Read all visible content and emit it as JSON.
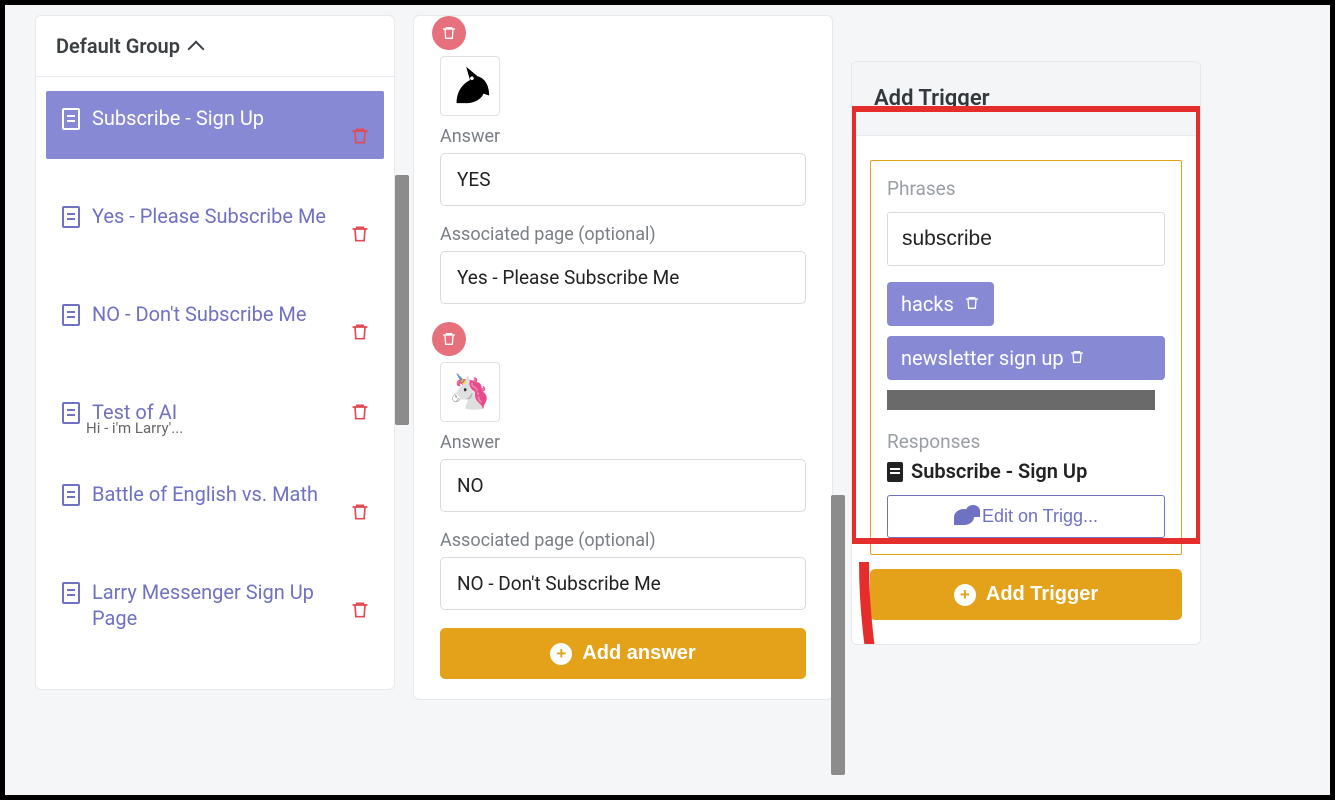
{
  "sidebar": {
    "title": "Default Group",
    "items": [
      {
        "label": "Subscribe - Sign Up",
        "active": true
      },
      {
        "label": "Yes - Please Subscribe Me"
      },
      {
        "label": "NO - Don't Subscribe Me"
      },
      {
        "label": "Test of AI",
        "sub": "Hi - i'm Larry'..."
      },
      {
        "label": "Battle of English vs. Math"
      },
      {
        "label": "Larry Messenger Sign Up Page"
      }
    ]
  },
  "answers": {
    "answer_label": "Answer",
    "associated_label": "Associated page (optional)",
    "blocks": [
      {
        "value": "YES",
        "page": "Yes - Please Subscribe Me",
        "avatar": "black-unicorn"
      },
      {
        "value": "NO",
        "page": "NO - Don't Subscribe Me",
        "avatar": "color-unicorn"
      }
    ],
    "add_button": "Add answer"
  },
  "trigger_panel": {
    "title": "Add Trigger",
    "phrases_label": "Phrases",
    "phrase_input": "subscribe",
    "chips": [
      {
        "text": "hacks",
        "deletable": true
      },
      {
        "text": "newsletter sign up",
        "deletable": true
      }
    ],
    "responses_label": "Responses",
    "response_name": "Subscribe - Sign Up",
    "edit_label": "Edit on Trigg...",
    "add_button": "Add Trigger"
  }
}
